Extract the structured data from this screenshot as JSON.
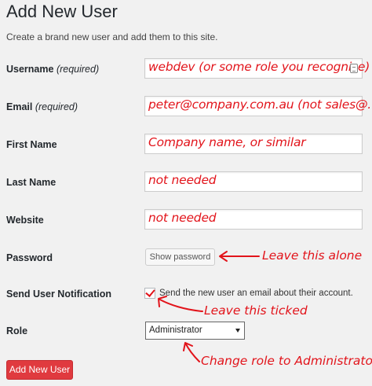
{
  "page": {
    "title": "Add New User",
    "subtitle": "Create a brand new user and add them to this site."
  },
  "fields": {
    "username": {
      "label": "Username",
      "required": "(required)",
      "value": "webdev (or some role you recognise)"
    },
    "email": {
      "label": "Email",
      "required": "(required)",
      "value": "peter@company.com.au (not sales@...)"
    },
    "first_name": {
      "label": "First Name",
      "value": "Company name, or similar"
    },
    "last_name": {
      "label": "Last Name",
      "value": "not needed"
    },
    "website": {
      "label": "Website",
      "value": "not needed"
    },
    "password": {
      "label": "Password",
      "button": "Show password"
    },
    "notification": {
      "label": "Send User Notification",
      "checked": true,
      "text": "Send the new user an email about their account."
    },
    "role": {
      "label": "Role",
      "selected": "Administrator"
    }
  },
  "submit": {
    "label": "Add New User"
  },
  "annotations": {
    "password": "Leave this alone",
    "notification": "Leave this ticked",
    "role": "Change role to Administrator"
  },
  "colors": {
    "annotation": "#e2141b",
    "primary_button": "#e03a3f",
    "background": "#f1f1f1"
  },
  "icons": {
    "username_field": "keyboard-icon"
  }
}
